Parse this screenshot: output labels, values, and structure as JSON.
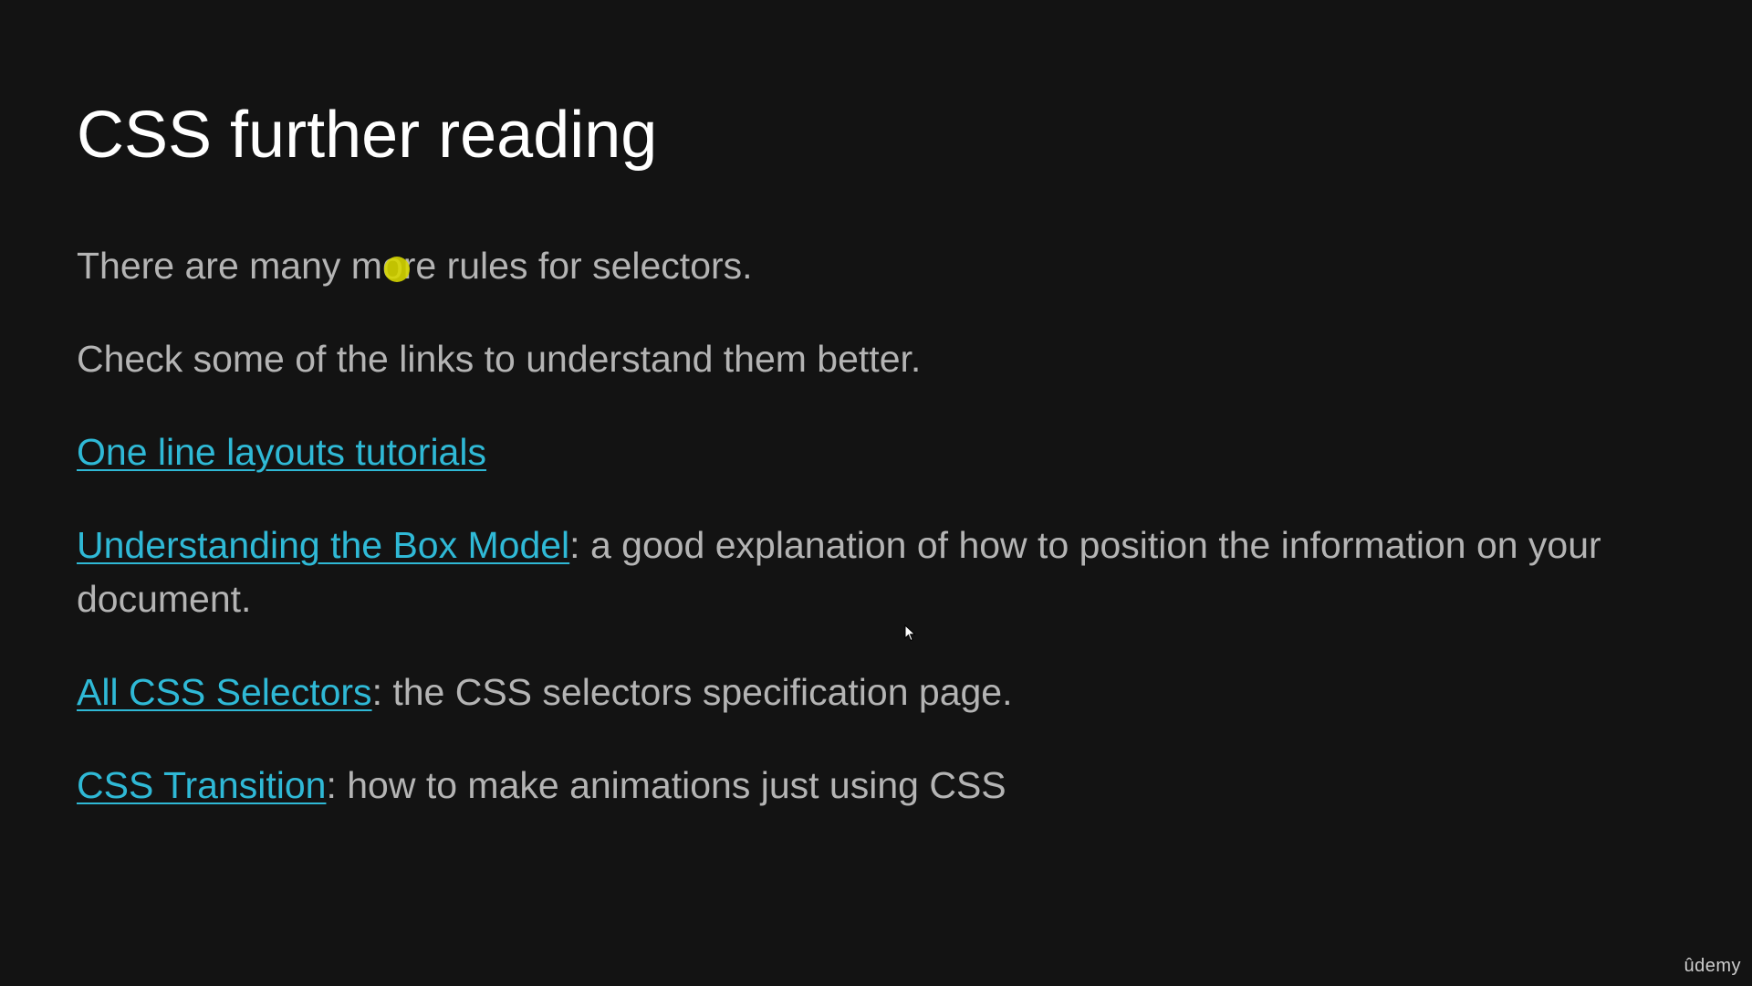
{
  "slide": {
    "title": "CSS further reading",
    "paragraphs": {
      "p1": "There are many more rules for selectors.",
      "p2": "Check some of the links to understand them better."
    },
    "links": {
      "one_line_layouts": {
        "label": "One line layouts tutorials"
      },
      "box_model": {
        "label": "Understanding the Box Model",
        "description": ": a good explanation of how to position the information on your document."
      },
      "all_css_selectors": {
        "label": "All CSS Selectors",
        "description": ": the CSS selectors specification page."
      },
      "css_transition": {
        "label": "CSS Transition",
        "description": ": how to make animations just using CSS"
      }
    }
  },
  "brand": {
    "name": "ûdemy"
  },
  "colors": {
    "background": "#131313",
    "title": "#ffffff",
    "text": "#b4b4b4",
    "link": "#2fb9d6",
    "highlight": "#d6d600"
  },
  "icons": {
    "pointer": "cursor-arrow-icon",
    "click_highlight": "yellow-dot-highlight"
  }
}
